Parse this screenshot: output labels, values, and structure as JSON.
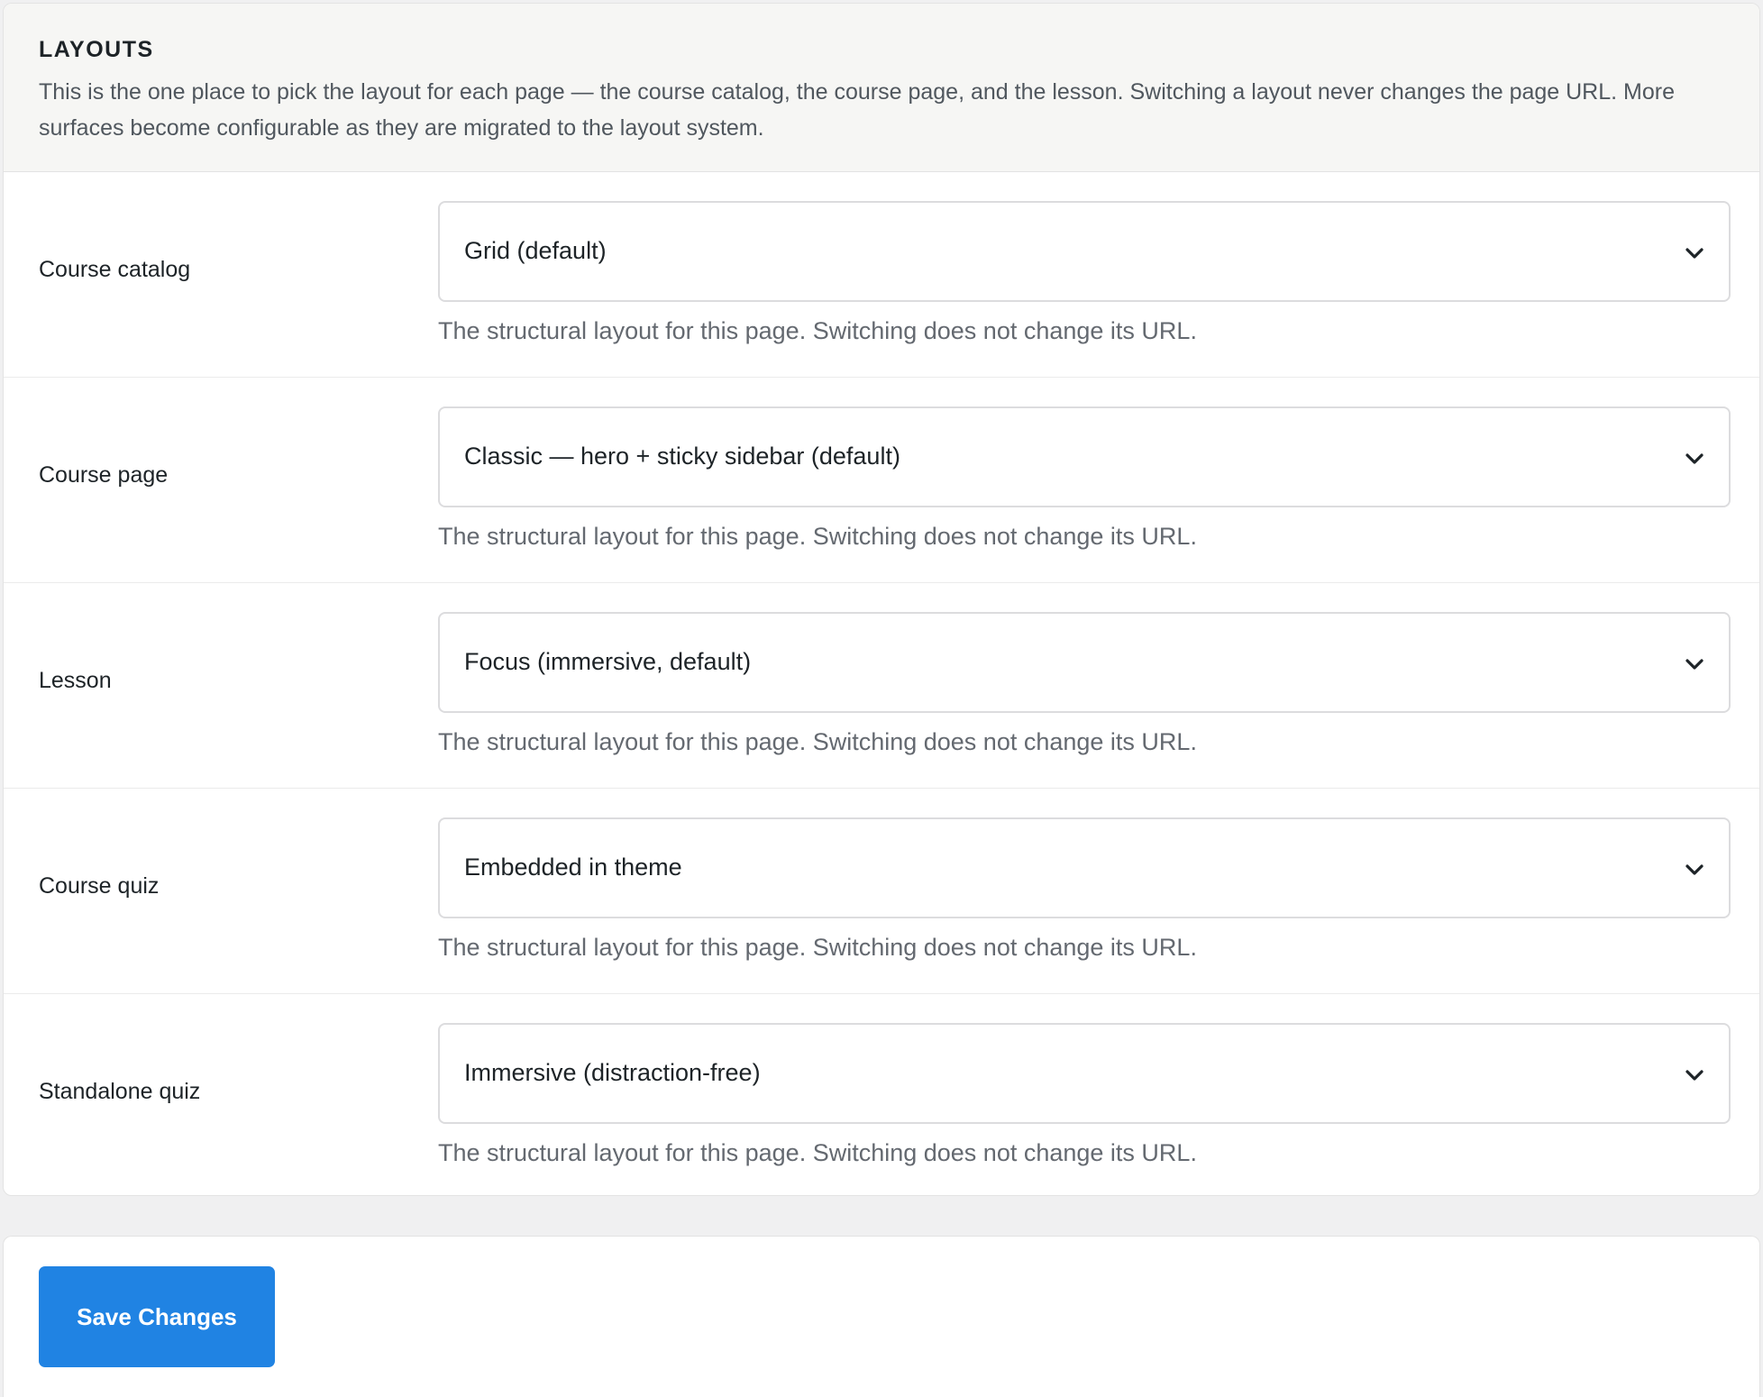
{
  "section": {
    "title": "LAYOUTS",
    "description": "This is the one place to pick the layout for each page — the course catalog, the course page, and the lesson. Switching a layout never changes the page URL. More surfaces become configurable as they are migrated to the layout system."
  },
  "rows": [
    {
      "label": "Course catalog",
      "selected": "Grid (default)",
      "help": "The structural layout for this page. Switching does not change its URL."
    },
    {
      "label": "Course page",
      "selected": "Classic — hero + sticky sidebar (default)",
      "help": "The structural layout for this page. Switching does not change its URL."
    },
    {
      "label": "Lesson",
      "selected": "Focus (immersive, default)",
      "help": "The structural layout for this page. Switching does not change its URL."
    },
    {
      "label": "Course quiz",
      "selected": "Embedded in theme",
      "help": "The structural layout for this page. Switching does not change its URL."
    },
    {
      "label": "Standalone quiz",
      "selected": "Immersive (distraction-free)",
      "help": "The structural layout for this page. Switching does not change its URL."
    }
  ],
  "footer": {
    "save_label": "Save Changes"
  },
  "colors": {
    "accent": "#2083e3",
    "header_bg": "#f6f6f4",
    "page_bg": "#f0f0f1"
  },
  "icons": {
    "select_chevron": "chevron-down-icon"
  }
}
